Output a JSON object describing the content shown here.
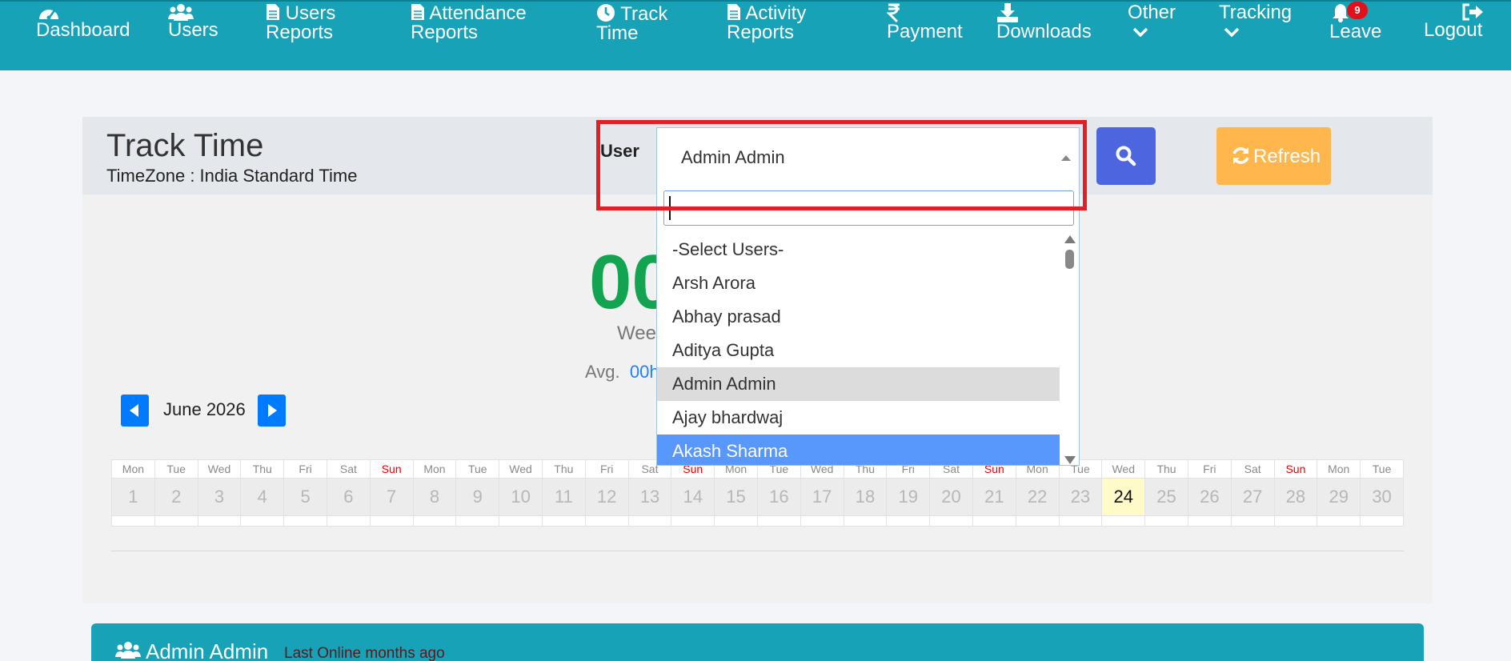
{
  "nav": {
    "dashboard": "Dashboard",
    "users": "Users",
    "users_reports_1": "Users",
    "users_reports_2": "Reports",
    "attendance_1": "Attendance",
    "attendance_2": "Reports",
    "track_1": "Track",
    "track_2": "Time",
    "activity_1": "Activity",
    "activity_2": "Reports",
    "payment": "Payment",
    "downloads": "Downloads",
    "other": "Other",
    "tracking": "Tracking",
    "leave": "Leave",
    "leave_badge": "9",
    "logout": "Logout"
  },
  "header": {
    "title": "Track Time",
    "timezone": "TimeZone : India Standard Time",
    "user_label": "User",
    "selected_user": "Admin Admin",
    "refresh_label": "Refresh"
  },
  "dropdown": {
    "search_value": "",
    "options": [
      "-Select Users-",
      "Arsh Arora",
      "Abhay prasad",
      "Aditya Gupta",
      "Admin Admin",
      "Ajay bhardwaj",
      "Akash Sharma"
    ],
    "current_index": 4,
    "hover_index": 6
  },
  "summary": {
    "big_time": "00",
    "week_label": "Week",
    "avg_label": "Avg.",
    "avg_value": "00h"
  },
  "calendar": {
    "month": "June 2026",
    "day_names": [
      "Mon",
      "Tue",
      "Wed",
      "Thu",
      "Fri",
      "Sat",
      "Sun",
      "Mon",
      "Tue",
      "Wed",
      "Thu",
      "Fri",
      "Sat",
      "Sun",
      "Mon",
      "Tue",
      "Wed",
      "Thu",
      "Fri",
      "Sat",
      "Sun",
      "Mon",
      "Tue",
      "Wed",
      "Thu",
      "Fri",
      "Sat",
      "Sun",
      "Mon",
      "Tue"
    ],
    "dates": [
      "1",
      "2",
      "3",
      "4",
      "5",
      "6",
      "7",
      "8",
      "9",
      "10",
      "11",
      "12",
      "13",
      "14",
      "15",
      "16",
      "17",
      "18",
      "19",
      "20",
      "21",
      "22",
      "23",
      "24",
      "25",
      "26",
      "27",
      "28",
      "29",
      "30"
    ],
    "today": "24"
  },
  "user_bar": {
    "name": "Admin Admin",
    "last_online": "Last Online months ago"
  },
  "colors": {
    "nav_bg": "#17a2b8",
    "accent_blue": "#4b66de",
    "refresh": "#ffb74d",
    "green": "#13a452",
    "highlight_red": "#e41e25"
  }
}
